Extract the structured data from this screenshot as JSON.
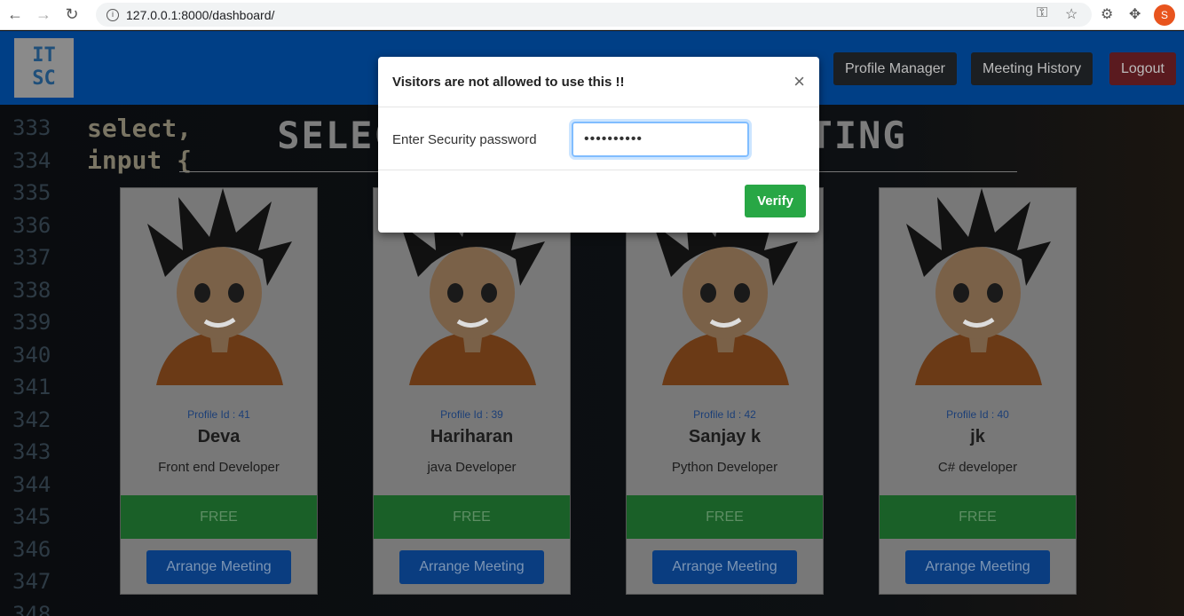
{
  "browser": {
    "url": "127.0.0.1:8000/dashboard/",
    "profile_initial": "S"
  },
  "nav": {
    "logo_line1": "IT",
    "logo_line2": "SC",
    "profile_manager": "Profile Manager",
    "meeting_history": "Meeting History",
    "logout": "Logout"
  },
  "page": {
    "title": "SELECT PROFILE FOR MEETING"
  },
  "background_code": {
    "line_numbers": [
      "333",
      "334",
      "335",
      "336",
      "337",
      "338",
      "339",
      "340",
      "341",
      "342",
      "343",
      "344",
      "345",
      "346",
      "347",
      "348"
    ]
  },
  "profiles": [
    {
      "id_label": "Profile Id : 41",
      "name": "Deva",
      "role": "Front end Developer",
      "status": "FREE",
      "action": "Arrange Meeting"
    },
    {
      "id_label": "Profile Id : 39",
      "name": "Hariharan",
      "role": "java Developer",
      "status": "FREE",
      "action": "Arrange Meeting"
    },
    {
      "id_label": "Profile Id : 42",
      "name": "Sanjay k",
      "role": "Python Developer",
      "status": "FREE",
      "action": "Arrange Meeting"
    },
    {
      "id_label": "Profile Id : 40",
      "name": "jk",
      "role": "C# developer",
      "status": "FREE",
      "action": "Arrange Meeting"
    }
  ],
  "modal": {
    "title": "Visitors are not allowed to use this !!",
    "close": "×",
    "label": "Enter Security password",
    "password_mask": "••••••••••",
    "verify": "Verify"
  }
}
